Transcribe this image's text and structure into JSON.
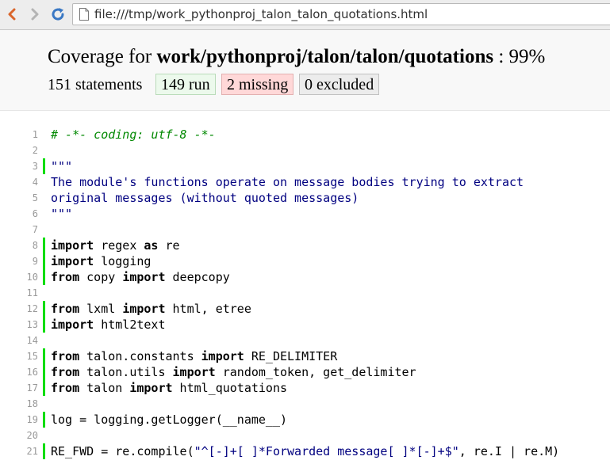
{
  "browser": {
    "url": "file:///tmp/work_pythonproj_talon_talon_quotations.html",
    "back_icon": "chevron-left-icon",
    "forward_icon": "chevron-right-icon",
    "reload_icon": "reload-icon",
    "page_icon": "page-icon"
  },
  "header": {
    "title_prefix": "Coverage for",
    "module_path": "work/pythonproj/talon/talon/quotations",
    "title_suffix": ": 99%",
    "statements": "151 statements",
    "run": "149 run",
    "missing": "2 missing",
    "excluded": "0 excluded"
  },
  "colors": {
    "run_marker": "#00dd00",
    "run_bg": "#ecf9ec",
    "missing_bg": "#ffd8d8",
    "excluded_bg": "#ececec",
    "comment": "#008800",
    "string": "#000080"
  },
  "lines": [
    {
      "n": "1",
      "run": false,
      "tokens": [
        {
          "t": "# -*- coding: utf-8 -*-",
          "c": "com"
        }
      ]
    },
    {
      "n": "2",
      "run": false,
      "tokens": []
    },
    {
      "n": "3",
      "run": true,
      "tokens": [
        {
          "t": "\"\"\"",
          "c": "str"
        }
      ]
    },
    {
      "n": "4",
      "run": false,
      "tokens": [
        {
          "t": "The module's functions operate on message bodies trying to extract",
          "c": "str"
        }
      ]
    },
    {
      "n": "5",
      "run": false,
      "tokens": [
        {
          "t": "original messages (without quoted messages)",
          "c": "str"
        }
      ]
    },
    {
      "n": "6",
      "run": false,
      "tokens": [
        {
          "t": "\"\"\"",
          "c": "str"
        }
      ]
    },
    {
      "n": "7",
      "run": false,
      "tokens": []
    },
    {
      "n": "8",
      "run": true,
      "tokens": [
        {
          "t": "import",
          "c": "key"
        },
        {
          "t": " regex ",
          "c": ""
        },
        {
          "t": "as",
          "c": "key"
        },
        {
          "t": " re",
          "c": ""
        }
      ]
    },
    {
      "n": "9",
      "run": true,
      "tokens": [
        {
          "t": "import",
          "c": "key"
        },
        {
          "t": " logging",
          "c": ""
        }
      ]
    },
    {
      "n": "10",
      "run": true,
      "tokens": [
        {
          "t": "from",
          "c": "key"
        },
        {
          "t": " copy ",
          "c": ""
        },
        {
          "t": "import",
          "c": "key"
        },
        {
          "t": " deepcopy",
          "c": ""
        }
      ]
    },
    {
      "n": "11",
      "run": false,
      "tokens": []
    },
    {
      "n": "12",
      "run": true,
      "tokens": [
        {
          "t": "from",
          "c": "key"
        },
        {
          "t": " lxml ",
          "c": ""
        },
        {
          "t": "import",
          "c": "key"
        },
        {
          "t": " html, etree",
          "c": ""
        }
      ]
    },
    {
      "n": "13",
      "run": true,
      "tokens": [
        {
          "t": "import",
          "c": "key"
        },
        {
          "t": " html2text",
          "c": ""
        }
      ]
    },
    {
      "n": "14",
      "run": false,
      "tokens": []
    },
    {
      "n": "15",
      "run": true,
      "tokens": [
        {
          "t": "from",
          "c": "key"
        },
        {
          "t": " talon.constants ",
          "c": ""
        },
        {
          "t": "import",
          "c": "key"
        },
        {
          "t": " RE_DELIMITER",
          "c": ""
        }
      ]
    },
    {
      "n": "16",
      "run": true,
      "tokens": [
        {
          "t": "from",
          "c": "key"
        },
        {
          "t": " talon.utils ",
          "c": ""
        },
        {
          "t": "import",
          "c": "key"
        },
        {
          "t": " random_token, get_delimiter",
          "c": ""
        }
      ]
    },
    {
      "n": "17",
      "run": true,
      "tokens": [
        {
          "t": "from",
          "c": "key"
        },
        {
          "t": " talon ",
          "c": ""
        },
        {
          "t": "import",
          "c": "key"
        },
        {
          "t": " html_quotations",
          "c": ""
        }
      ]
    },
    {
      "n": "18",
      "run": false,
      "tokens": []
    },
    {
      "n": "19",
      "run": true,
      "tokens": [
        {
          "t": "log = logging.getLogger(__name__)",
          "c": ""
        }
      ]
    },
    {
      "n": "20",
      "run": false,
      "tokens": []
    },
    {
      "n": "21",
      "run": true,
      "tokens": [
        {
          "t": "RE_FWD = re.compile(",
          "c": ""
        },
        {
          "t": "\"^[-]+[ ]*Forwarded message[ ]*[-]+$\"",
          "c": "str"
        },
        {
          "t": ", re.I | re.M)",
          "c": ""
        }
      ]
    }
  ]
}
